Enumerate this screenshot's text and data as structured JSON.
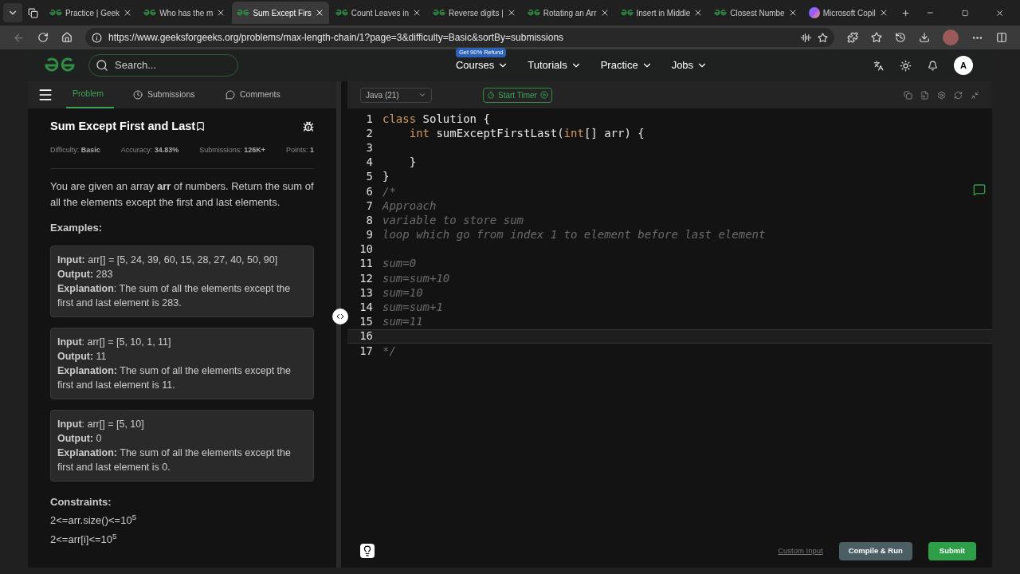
{
  "browser": {
    "tabs": [
      {
        "label": "Practice | Geek",
        "selected": false
      },
      {
        "label": "Who has the m",
        "selected": false
      },
      {
        "label": "Sum Except Firs",
        "selected": true
      },
      {
        "label": "Count Leaves in",
        "selected": false
      },
      {
        "label": "Reverse digits |",
        "selected": false
      },
      {
        "label": "Rotating an Arr",
        "selected": false
      },
      {
        "label": "Insert in Middle",
        "selected": false
      },
      {
        "label": "Closest Numbe",
        "selected": false
      },
      {
        "label": "Microsoft Copil",
        "selected": false,
        "kind": "copilot"
      }
    ],
    "url": "https://www.geeksforgeeks.org/problems/max-length-chain/1?page=3&difficulty=Basic&sortBy=submissions"
  },
  "site_nav": {
    "search_placeholder": "Search...",
    "promo_badge": "Get 90% Refund",
    "menus": [
      "Courses",
      "Tutorials",
      "Practice",
      "Jobs"
    ],
    "avatar": "A"
  },
  "problem_tabs": [
    {
      "label": "Problem",
      "selected": true,
      "kind": "problem"
    },
    {
      "label": "Submissions",
      "selected": false,
      "kind": "clock"
    },
    {
      "label": "Comments",
      "selected": false,
      "kind": "comment"
    }
  ],
  "problem": {
    "title": "Sum Except First and Last",
    "stats": [
      {
        "label": "Difficulty:",
        "value": "Basic"
      },
      {
        "label": "Accuracy:",
        "value": "34.83%"
      },
      {
        "label": "Submissions:",
        "value": "126K+"
      },
      {
        "label": "Points:",
        "value": "1"
      }
    ],
    "description": "You are given an array **arr** of numbers. Return the sum of all the elements except the first and last elements.",
    "examples_heading": "Examples:",
    "examples": [
      {
        "input": "**Input:** arr[] = [5, 24, 39, 60, 15, 28, 27, 40, 50, 90]",
        "output": "**Output:** 283",
        "explanation": "**Explanation**: The sum of all the elements except the first and last element is 283."
      },
      {
        "input": "**Input**: arr[] = [5, 10, 1, 11]",
        "output": "**Output:** 11",
        "explanation": "**Explanation:** The sum of all the elements except the first and last element is 11."
      },
      {
        "input": "**Input**: arr[] = [5, 10]",
        "output": "**Output:** 0",
        "explanation": "**Explanation:** The sum of all the elements except the first and last element is 0."
      }
    ],
    "constraints_heading": "Constraints:",
    "constraints": [
      "2<=arr.size()<=10$^{5}$",
      "2<=arr[i]<=10$^{5}$"
    ]
  },
  "editor": {
    "language": "Java (21)",
    "timer_button": "Start Timer",
    "lines": [
      {
        "number": "1",
        "selected": false,
        "tokens": [
          {
            "text": "class",
            "kind": "keyword"
          },
          {
            "text": " Solution {",
            "kind": "plain"
          }
        ]
      },
      {
        "number": "2",
        "selected": false,
        "tokens": [
          {
            "text": "    int",
            "kind": "keyword"
          },
          {
            "text": " sumExceptFirstLast(",
            "kind": "plain"
          },
          {
            "text": "int",
            "kind": "keyword"
          },
          {
            "text": "[] arr) {",
            "kind": "plain"
          }
        ]
      },
      {
        "number": "3",
        "selected": false
      },
      {
        "number": "4",
        "selected": false,
        "tokens": [
          {
            "text": "    }",
            "kind": "plain"
          }
        ]
      },
      {
        "number": "5",
        "selected": false,
        "tokens": [
          {
            "text": "}",
            "kind": "plain"
          }
        ]
      },
      {
        "number": "6",
        "selected": false,
        "tokens": [
          {
            "text": "/*",
            "kind": "comment"
          }
        ]
      },
      {
        "number": "7",
        "selected": false,
        "tokens": [
          {
            "text": "Approach",
            "kind": "comment"
          }
        ]
      },
      {
        "number": "8",
        "selected": false,
        "tokens": [
          {
            "text": "variable to store sum",
            "kind": "comment"
          }
        ]
      },
      {
        "number": "9",
        "selected": false,
        "tokens": [
          {
            "text": "loop which go from index 1 to element before last element",
            "kind": "comment"
          }
        ]
      },
      {
        "number": "10",
        "selected": false
      },
      {
        "number": "11",
        "selected": false,
        "tokens": [
          {
            "text": "sum=0",
            "kind": "comment"
          }
        ]
      },
      {
        "number": "12",
        "selected": false,
        "tokens": [
          {
            "text": "sum=sum+10",
            "kind": "comment"
          }
        ]
      },
      {
        "number": "13",
        "selected": false,
        "tokens": [
          {
            "text": "sum=10",
            "kind": "comment"
          }
        ]
      },
      {
        "number": "14",
        "selected": false,
        "tokens": [
          {
            "text": "sum=sum+1",
            "kind": "comment"
          }
        ]
      },
      {
        "number": "15",
        "selected": false,
        "tokens": [
          {
            "text": "sum=11",
            "kind": "comment"
          }
        ]
      },
      {
        "number": "16",
        "selected": true
      },
      {
        "number": "17",
        "selected": false,
        "tokens": [
          {
            "text": "*/",
            "kind": "comment"
          }
        ]
      }
    ],
    "custom_input": "Custom Input",
    "compile_button": "Compile & Run",
    "submit_button": "Submit"
  }
}
